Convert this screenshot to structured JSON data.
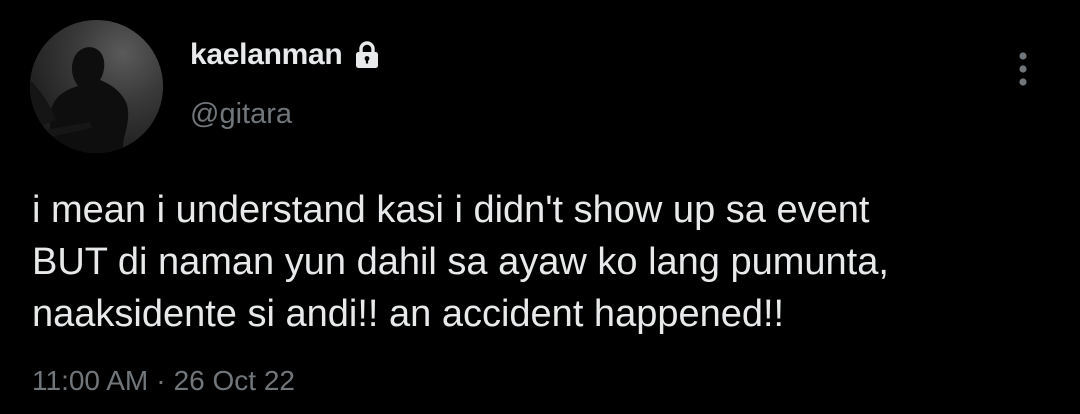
{
  "user": {
    "display_name": "kaelanman",
    "handle": "@gitara",
    "protected_icon": "lock-icon",
    "avatar_icon": "profile-photo"
  },
  "tweet": {
    "lines": [
      "i mean i understand kasi i didn't show up sa event",
      "BUT di naman yun dahil sa ayaw ko lang pumunta,",
      "naaksidente si andi!! an accident happened!!"
    ],
    "time": "11:00 AM",
    "separator": "·",
    "date": "26 Oct 22"
  },
  "actions": {
    "more_icon": "more-vertical-icon"
  },
  "colors": {
    "background": "#000000",
    "text_primary": "#e7e9ea",
    "text_secondary": "#71767b"
  }
}
